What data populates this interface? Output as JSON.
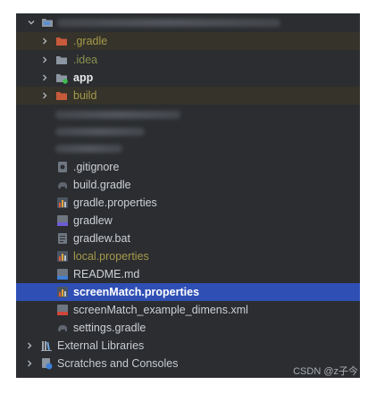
{
  "project": {
    "rows": [
      {
        "label": ".gradle",
        "icon": "folder-excluded-icon",
        "excluded": true
      },
      {
        "label": ".idea",
        "icon": "folder-icon"
      },
      {
        "label": "app",
        "icon": "module-folder-icon"
      },
      {
        "label": "build",
        "icon": "folder-excluded-icon",
        "excluded": true
      }
    ],
    "files": [
      {
        "label": ".gitignore",
        "icon": "gitignore-file-icon"
      },
      {
        "label": "build.gradle",
        "icon": "gradle-elephant-icon"
      },
      {
        "label": "gradle.properties",
        "icon": "properties-file-icon"
      },
      {
        "label": "gradlew",
        "icon": "shell-script-icon"
      },
      {
        "label": "gradlew.bat",
        "icon": "text-file-icon"
      },
      {
        "label": "local.properties",
        "icon": "properties-file-icon",
        "excluded": true
      },
      {
        "label": "README.md",
        "icon": "markdown-file-icon"
      },
      {
        "label": "screenMatch.properties",
        "icon": "properties-file-icon",
        "selected": true
      },
      {
        "label": "screenMatch_example_dimens.xml",
        "icon": "xml-file-icon"
      },
      {
        "label": "settings.gradle",
        "icon": "gradle-elephant-icon"
      }
    ]
  },
  "external_libraries": {
    "label": "External Libraries",
    "icon": "libraries-icon"
  },
  "scratches": {
    "label": "Scratches and Consoles",
    "icon": "scratches-icon"
  },
  "watermark": "CSDN @z子今",
  "colors": {
    "panel_bg": "#2b2d30",
    "selected_bg": "#2f4fb5",
    "excluded_bg": "#35332a",
    "excluded_text": "#a79a4a"
  }
}
